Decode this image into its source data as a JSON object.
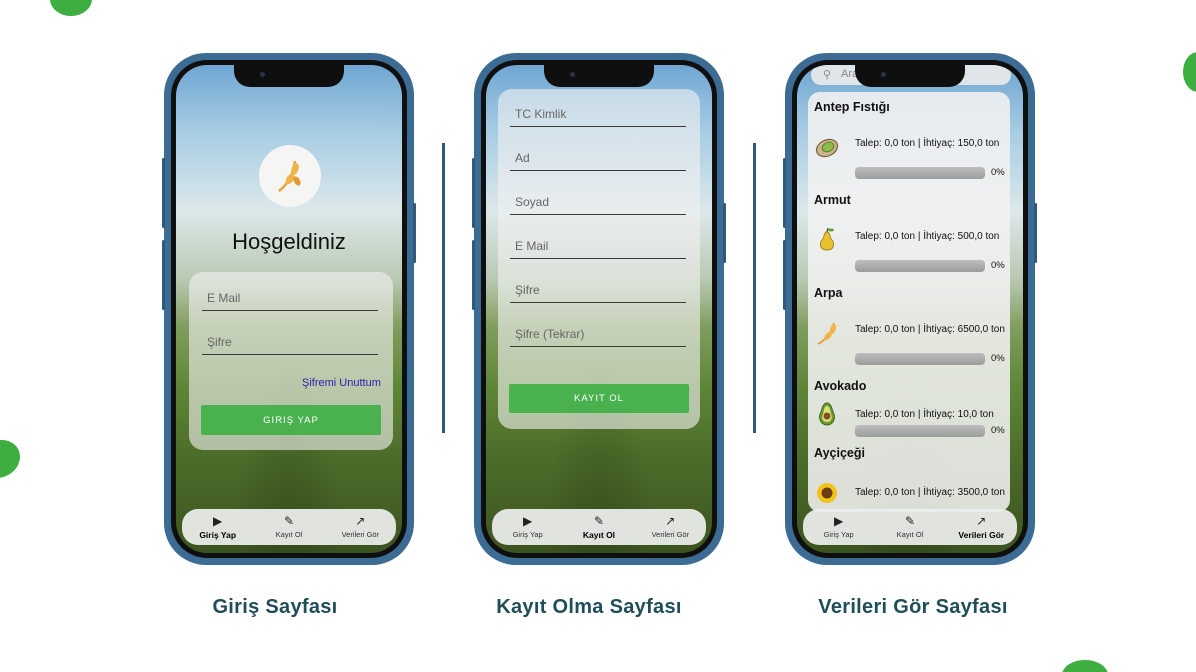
{
  "pages": {
    "login": {
      "caption": "Giriş Sayfası",
      "welcome": "Hoşgeldiniz",
      "email_placeholder": "E Mail",
      "password_placeholder": "Şifre",
      "forgot_link": "Şifremi Unuttum",
      "login_button": "GIRIŞ YAP"
    },
    "register": {
      "caption": "Kayıt Olma Sayfası",
      "fields": [
        "TC Kimlik",
        "Ad",
        "Soyad",
        "E Mail",
        "Şifre",
        "Şifre (Tekrar)"
      ],
      "register_button": "KAYIT OL"
    },
    "data": {
      "caption": "Verileri Gör Sayfası",
      "search_placeholder": "Ara",
      "items": [
        {
          "name": "Antep Fıstığı",
          "info": "Talep: 0,0 ton | İhtiyaç: 150,0 ton",
          "progress": 0,
          "percent_label": "0%",
          "icon": "pistachio-icon"
        },
        {
          "name": "Armut",
          "info": "Talep: 0,0 ton | İhtiyaç: 500,0 ton",
          "progress": 0,
          "percent_label": "0%",
          "icon": "pear-icon"
        },
        {
          "name": "Arpa",
          "info": "Talep: 0,0 ton | İhtiyaç: 6500,0 ton",
          "progress": 0,
          "percent_label": "0%",
          "icon": "barley-icon"
        },
        {
          "name": "Avokado",
          "info": "Talep: 0,0 ton | İhtiyaç: 10,0 ton",
          "progress": 0,
          "percent_label": "0%",
          "icon": "avocado-icon"
        },
        {
          "name": "Ayçiçeği",
          "info": "Talep: 0,0 ton | İhtiyaç: 3500,0 ton",
          "progress": 0,
          "percent_label": "",
          "icon": "sunflower-icon"
        }
      ]
    }
  },
  "bottom_nav": {
    "items": [
      {
        "label": "Giriş Yap",
        "icon": "play-icon"
      },
      {
        "label": "Kayıt Ol",
        "icon": "pencil-icon"
      },
      {
        "label": "Verileri Gör",
        "icon": "trending-up-icon"
      }
    ],
    "active_per_page": {
      "login": 0,
      "register": 1,
      "data": 2
    }
  },
  "colors": {
    "accent_green": "#49b24e",
    "phone_frame": "#3c6c93",
    "caption": "#1f4d58",
    "link": "#2a1fb0"
  }
}
